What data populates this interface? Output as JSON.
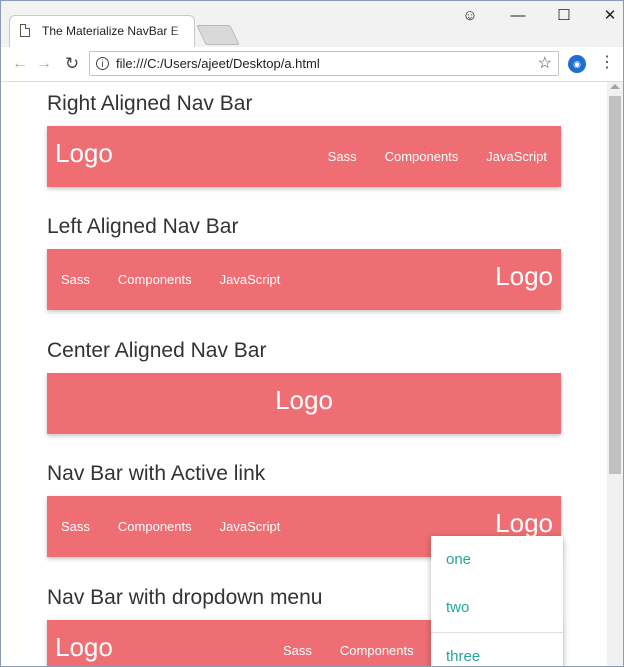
{
  "browser": {
    "tab_title": "The Materialize NavBar E",
    "url": "file:///C:/Users/ajeet/Desktop/a.html",
    "icons": [
      "back-icon",
      "forward-icon",
      "reload-icon",
      "info-icon",
      "star-icon",
      "extension-icon",
      "menu-icon",
      "profile-icon"
    ]
  },
  "sections": {
    "right": {
      "heading": "Right Aligned Nav Bar",
      "logo": "Logo",
      "links": [
        "Sass",
        "Components",
        "JavaScript"
      ]
    },
    "left": {
      "heading": "Left Aligned Nav Bar",
      "logo": "Logo",
      "links": [
        "Sass",
        "Components",
        "JavaScript"
      ]
    },
    "center": {
      "heading": "Center Aligned Nav Bar",
      "logo": "Logo"
    },
    "active": {
      "heading": "Nav Bar with Active link",
      "logo": "Logo",
      "links": [
        "Sass",
        "Components",
        "JavaScript"
      ]
    },
    "dropdown": {
      "heading": "Nav Bar with dropdown menu",
      "logo": "Logo",
      "links": [
        "Sass",
        "Components"
      ]
    }
  },
  "dropdown_menu": {
    "items": [
      "one",
      "two",
      "three"
    ]
  },
  "colors": {
    "nav_bg": "#ee6e73",
    "dropdown_text": "#26a69a"
  }
}
